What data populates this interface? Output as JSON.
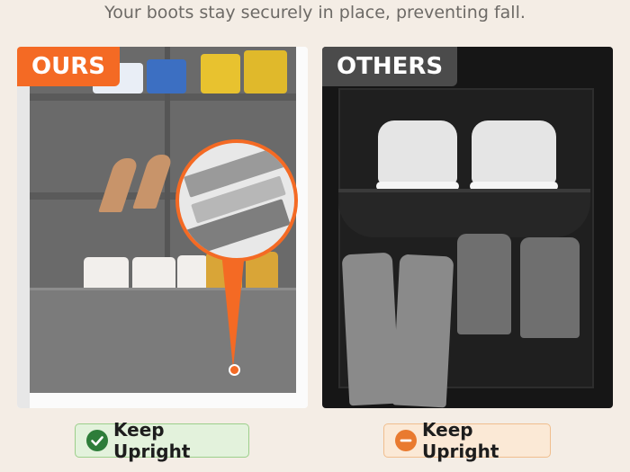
{
  "headline": "Your boots stay securely in place, preventing fall.",
  "left_panel": {
    "tag": "OURS",
    "badge_label": "Keep Upright",
    "badge_icon": "check-circle-icon",
    "accent_color": "#f46a24"
  },
  "right_panel": {
    "tag": "OTHERS",
    "badge_label": "Keep Upright",
    "badge_icon": "minus-circle-icon",
    "accent_color": "#4b4b4b"
  }
}
